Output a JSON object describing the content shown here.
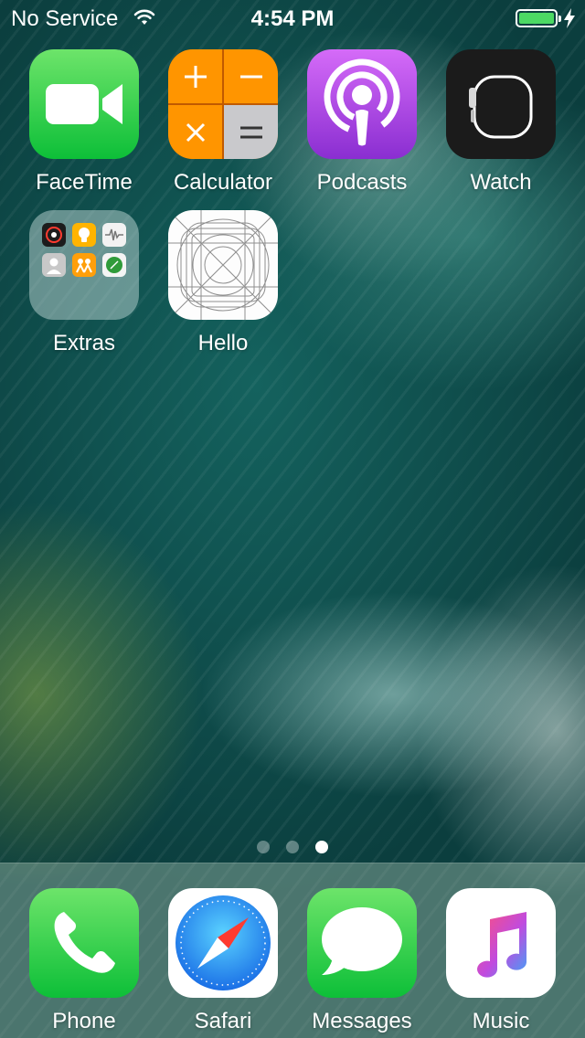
{
  "status_bar": {
    "carrier": "No Service",
    "time": "4:54 PM",
    "battery_color": "#4cd964"
  },
  "home_screen": {
    "apps": [
      {
        "label": "FaceTime",
        "icon": "facetime-icon"
      },
      {
        "label": "Calculator",
        "icon": "calculator-icon"
      },
      {
        "label": "Podcasts",
        "icon": "podcasts-icon"
      },
      {
        "label": "Watch",
        "icon": "watch-icon"
      },
      {
        "label": "Extras",
        "icon": "folder-icon"
      },
      {
        "label": "Hello",
        "icon": "icon-grid-template-icon"
      }
    ]
  },
  "page_indicator": {
    "pages": 3,
    "current": 3
  },
  "dock": {
    "apps": [
      {
        "label": "Phone",
        "icon": "phone-icon"
      },
      {
        "label": "Safari",
        "icon": "compass-icon"
      },
      {
        "label": "Messages",
        "icon": "speech-bubble-icon"
      },
      {
        "label": "Music",
        "icon": "music-note-icon"
      }
    ]
  }
}
